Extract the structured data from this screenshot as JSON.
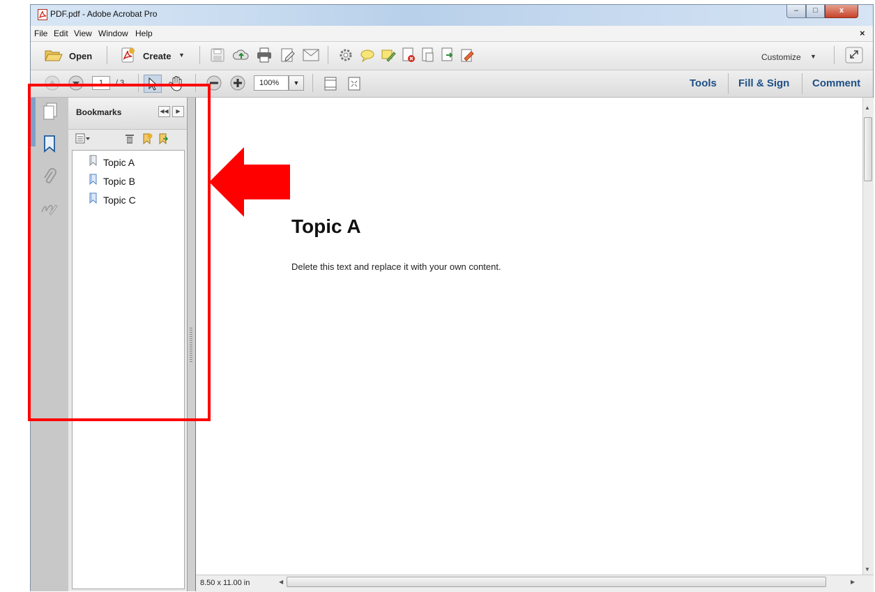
{
  "window": {
    "title": "PDF.pdf - Adobe Acrobat Pro",
    "controls": {
      "minimize": "–",
      "maximize": "□",
      "close": "x"
    }
  },
  "menu": {
    "items": [
      "File",
      "Edit",
      "View",
      "Window",
      "Help"
    ],
    "close_label": "×"
  },
  "toolbar": {
    "open_label": "Open",
    "create_label": "Create",
    "customize_label": "Customize"
  },
  "navigation": {
    "page_number": "1",
    "page_total": "/ 3",
    "zoom": "100%"
  },
  "panes": {
    "tools": "Tools",
    "fill_sign": "Fill & Sign",
    "comment": "Comment"
  },
  "bookmarks": {
    "title": "Bookmarks",
    "items": [
      "Topic A",
      "Topic B",
      "Topic C"
    ]
  },
  "document": {
    "heading": "Topic A",
    "body": "Delete this text and replace it with your own content."
  },
  "status": {
    "page_size": "8.50 x 11.00 in"
  },
  "colors": {
    "annotation": "#ff0000",
    "pane_link": "#1d4f86"
  }
}
